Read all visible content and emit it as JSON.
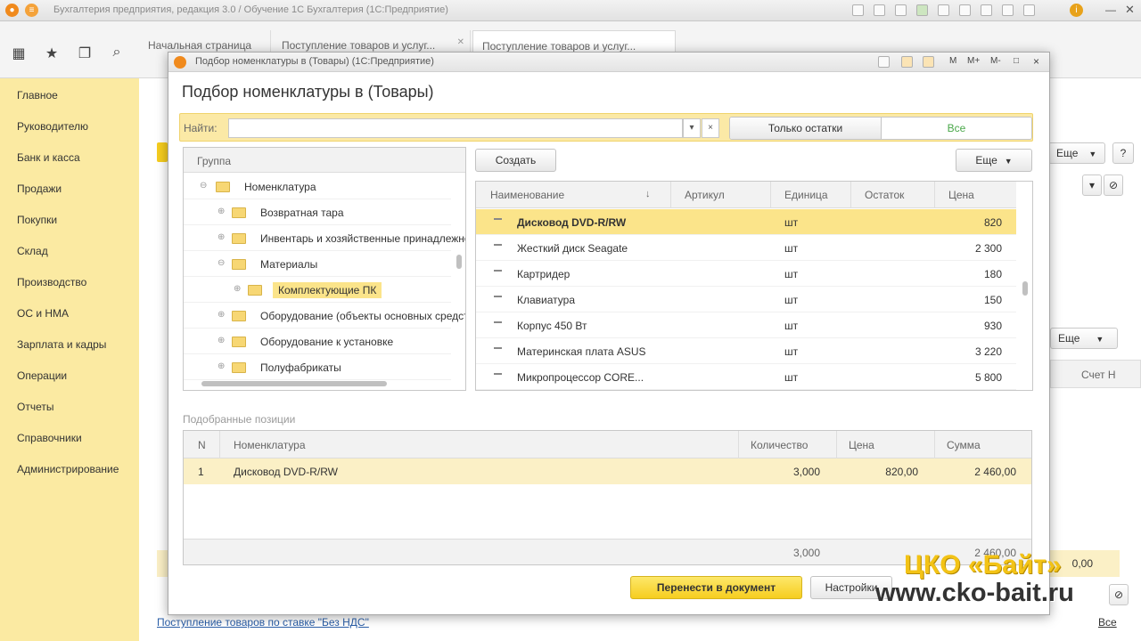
{
  "window": {
    "title": "Бухгалтерия предприятия, редакция 3.0 / Обучение 1С Бухгалтерия (1С:Предприятие)"
  },
  "tabs": [
    {
      "label": "Начальная страница"
    },
    {
      "label": "Поступление товаров и услуг..."
    },
    {
      "label": "Поступление товаров и услуг..."
    }
  ],
  "sidebar": {
    "items": [
      {
        "label": "Главное"
      },
      {
        "label": "Руководителю"
      },
      {
        "label": "Банк и касса"
      },
      {
        "label": "Продажи"
      },
      {
        "label": "Покупки"
      },
      {
        "label": "Склад"
      },
      {
        "label": "Производство"
      },
      {
        "label": "ОС и НМА"
      },
      {
        "label": "Зарплата и кадры"
      },
      {
        "label": "Операции"
      },
      {
        "label": "Отчеты"
      },
      {
        "label": "Справочники"
      },
      {
        "label": "Администрирование"
      }
    ]
  },
  "background": {
    "more_label": "Еще",
    "account_col": "Счет Н",
    "total_value": "0,00",
    "vat_link": "Поступление товаров по ставке \"Без НДС\"",
    "all_link": "Все"
  },
  "dialog": {
    "window_title": "Подбор номенклатуры в (Товары) (1С:Предприятие)",
    "heading": "Подбор номенклатуры в (Товары)",
    "controls": [
      "M",
      "M+",
      "M-",
      "□",
      "×"
    ],
    "search": {
      "label": "Найти:",
      "value": "",
      "dropdown_icon": "▾",
      "clear_icon": "×"
    },
    "filter": {
      "only_rest": "Только остатки",
      "all": "Все"
    },
    "group": {
      "header": "Группа",
      "tree": [
        {
          "label": "Номенклатура",
          "level": 0
        },
        {
          "label": "Возвратная тара",
          "level": 1
        },
        {
          "label": "Инвентарь и хозяйственные принадлежности",
          "level": 1
        },
        {
          "label": "Материалы",
          "level": 1
        },
        {
          "label": "Комплектующие ПК",
          "level": 2,
          "selected": true
        },
        {
          "label": "Оборудование (объекты основных средств)",
          "level": 1
        },
        {
          "label": "Оборудование к установке",
          "level": 1
        },
        {
          "label": "Полуфабрикаты",
          "level": 1
        }
      ]
    },
    "create_label": "Создать",
    "more_label": "Еще",
    "items": {
      "columns": [
        "Наименование",
        "Артикул",
        "Единица",
        "Остаток",
        "Цена"
      ],
      "rows": [
        {
          "name": "Дисковод DVD-R/RW",
          "article": "",
          "unit": "шт",
          "rest": "",
          "price": "820",
          "selected": true
        },
        {
          "name": "Жесткий диск Seagate",
          "article": "",
          "unit": "шт",
          "rest": "",
          "price": "2 300"
        },
        {
          "name": "Картридер",
          "article": "",
          "unit": "шт",
          "rest": "",
          "price": "180"
        },
        {
          "name": "Клавиатура",
          "article": "",
          "unit": "шт",
          "rest": "",
          "price": "150"
        },
        {
          "name": "Корпус 450 Вт",
          "article": "",
          "unit": "шт",
          "rest": "",
          "price": "930"
        },
        {
          "name": "Материнская плата ASUS",
          "article": "",
          "unit": "шт",
          "rest": "",
          "price": "3 220"
        },
        {
          "name": "Микропроцессор CORE...",
          "article": "",
          "unit": "шт",
          "rest": "",
          "price": "5 800"
        }
      ]
    },
    "selected": {
      "title": "Подобранные позиции",
      "columns": [
        "N",
        "Номенклатура",
        "Количество",
        "Цена",
        "Сумма"
      ],
      "rows": [
        {
          "n": "1",
          "name": "Дисковод DVD-R/RW",
          "qty": "3,000",
          "price": "820,00",
          "sum": "2 460,00"
        }
      ],
      "total_qty": "3,000",
      "total_sum": "2 460,00"
    },
    "transfer_label": "Перенести в документ",
    "settings_label": "Настройки"
  },
  "watermark": {
    "line1": "ЦКО «Байт»",
    "line2": "www.cko-bait.ru"
  },
  "colors": {
    "accent_yellow": "#f6cd1f",
    "sidebar_bg": "#fbeaa2",
    "selected_row": "#fbe48a",
    "link_blue": "#2a5ea8",
    "filter_active": "#4aa84a"
  }
}
